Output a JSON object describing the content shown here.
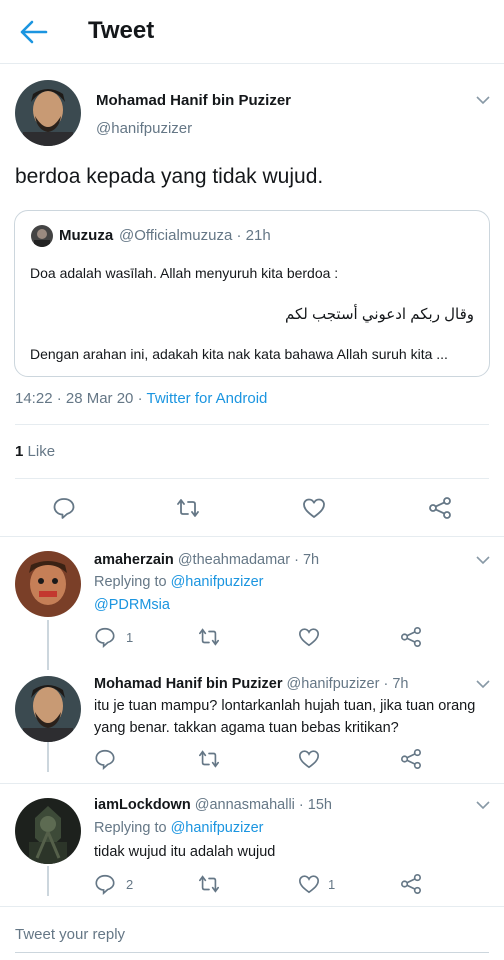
{
  "header": {
    "title": "Tweet",
    "back_icon": "arrow-left-icon"
  },
  "colors": {
    "accent": "#1b95e0",
    "muted": "#657786",
    "text": "#14171a",
    "border": "#e6ecf0"
  },
  "main_tweet": {
    "author_name": "Mohamad Hanif bin Puzizer",
    "author_handle": "@hanifpuzizer",
    "text": "berdoa kepada yang tidak wujud.",
    "quoted": {
      "author_name": "Muzuza",
      "author_handle": "@Officialmuzuza",
      "time": "· 21h",
      "line1": "Doa adalah wasīlah. Allah menyuruh kita berdoa :",
      "arabic": "وقال ربكم ادعوني أستجب لكم",
      "line3": "Dengan arahan ini, adakah kita nak kata bahawa Allah suruh kita ..."
    },
    "timestamp": "14:22 · 28 Mar 20 ·",
    "client": "Twitter for Android",
    "like_count": "1",
    "like_label": "Like"
  },
  "replies": [
    {
      "author_name": "amaherzain",
      "author_handle": "@theahmadamar",
      "time": "· 7h",
      "replying_label": "Replying to",
      "replying_to": "@hanifpuzizer",
      "line1_link": "@PDRMsia",
      "reply_count": "1",
      "like_count": ""
    },
    {
      "author_name": "Mohamad Hanif bin Puzizer",
      "author_handle": "@hanifpuzizer",
      "time": "· 7h",
      "line1": "itu je tuan mampu? lontarkanlah hujah tuan, jika tuan orang",
      "line2": "yang benar. takkan agama tuan bebas kritikan?",
      "reply_count": "",
      "like_count": ""
    },
    {
      "author_name": "iamLockdown",
      "author_handle": "@annasmahalli",
      "time": "· 15h",
      "replying_label": "Replying to",
      "replying_to": "@hanifpuzizer",
      "line1": "tidak wujud itu adalah wujud",
      "reply_count": "2",
      "like_count": "1"
    }
  ],
  "composer": {
    "placeholder": "Tweet your reply"
  }
}
